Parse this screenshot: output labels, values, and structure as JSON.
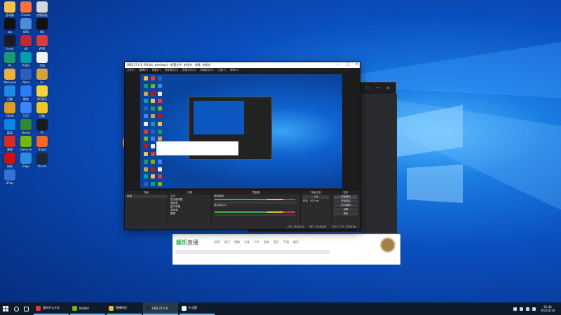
{
  "desktop": {
    "icons": [
      {
        "label": "此电脑",
        "color": "#f3c24b"
      },
      {
        "label": "Firefox",
        "color": "#ff7139"
      },
      {
        "label": "控制面板",
        "color": "#d8d8d8"
      },
      {
        "label": "ww",
        "color": "#111111"
      },
      {
        "label": "OBS",
        "color": "#4a8fd6"
      },
      {
        "label": "QQ",
        "color": "#111111"
      },
      {
        "label": "Faceit",
        "color": "#1b1b1b"
      },
      {
        "label": "UU",
        "color": "#cc2233"
      },
      {
        "label": "WPS",
        "color": "#e03a3a"
      },
      {
        "label": "PS",
        "color": "#1a9c6a"
      },
      {
        "label": "PUBG",
        "color": "#00a0b0"
      },
      {
        "label": "文档",
        "color": "#f4f4f4"
      },
      {
        "label": "WeGame",
        "color": "#e8b23b"
      },
      {
        "label": "Word",
        "color": "#2b5fb8"
      },
      {
        "label": "Go",
        "color": "#d6a23a"
      },
      {
        "label": "迅雷",
        "color": "#1e88e5"
      },
      {
        "label": "酷狗",
        "color": "#2e7bf6"
      },
      {
        "label": "QQ音乐",
        "color": "#f7d53a"
      },
      {
        "label": "CSGO",
        "color": "#dd9b2a"
      },
      {
        "label": "钉钉",
        "color": "#3a86ff"
      },
      {
        "label": "优酷",
        "color": "#f2c623"
      },
      {
        "label": "酷我",
        "color": "#0a86e3"
      },
      {
        "label": "Nvidia",
        "color": "#2f8a2f"
      },
      {
        "label": "Ps",
        "color": "#1a1a1a"
      },
      {
        "label": "雷神",
        "color": "#d92a2a"
      },
      {
        "label": "GeForce",
        "color": "#76b900"
      },
      {
        "label": "Origin",
        "color": "#f26b21"
      },
      {
        "label": "网易",
        "color": "#cc1111"
      },
      {
        "label": "Edge",
        "color": "#2c8ce0"
      },
      {
        "label": "Steam",
        "color": "#1b2838"
      },
      {
        "label": "UPlay",
        "color": "#2f75d1"
      }
    ]
  },
  "obs": {
    "title": "OBS 27.0.0 (64-bit, windows) - 配置文件: 未命名 - 场景: 未命名",
    "menu": [
      "文件(F)",
      "编辑(E)",
      "视图(V)",
      "停靠部件(D)",
      "配置文件(P)",
      "场景集合(S)",
      "工具(T)",
      "帮助(H)"
    ],
    "docks": {
      "scenes": {
        "header": "场景",
        "items": [
          "场景"
        ]
      },
      "sources": {
        "header": "来源",
        "items": [
          "文字",
          "显示器采集",
          "媒体源",
          "窗口采集",
          "游戏源",
          "图像"
        ]
      },
      "mixer": {
        "header": "混音器",
        "tracks": [
          "桌面音频",
          "麦克风/Aux"
        ]
      },
      "transitions": {
        "header": "场景过渡",
        "mode": "淡出",
        "duration_label": "时长",
        "duration": "300 ms"
      },
      "controls": {
        "header": "控件",
        "buttons": [
          "开始推流",
          "开始录制",
          "工作室模式",
          "设置",
          "退出"
        ]
      }
    },
    "status": [
      "LIVE: 00:00:00",
      "REC: 00:00:00",
      "CPU: 2.3%, 30.00 fps"
    ]
  },
  "music_app": {
    "logo_brand": "娱乐",
    "logo_rest": "直播",
    "tabs": [
      "首页",
      "热门",
      "频道",
      "分类",
      "户外",
      "游戏",
      "音乐",
      "手游",
      "娱乐"
    ]
  },
  "back_app": {
    "top_icons": [
      "⋮",
      "⬚",
      "─",
      "✕"
    ],
    "circle_label": "开始直播",
    "pill_label": "开播"
  },
  "taskbar": {
    "apps": [
      {
        "label": "我的开公众号",
        "color": "#e03a3a",
        "active": false
      },
      {
        "label": "NVIDIA",
        "color": "#76b900",
        "active": false
      },
      {
        "label": "直播伴侣",
        "color": "#e8b23b",
        "active": false
      },
      {
        "label": "OBS 27.0.0",
        "color": "#2c2c2c",
        "active": true
      },
      {
        "label": "9 设置",
        "color": "#ffffff",
        "active": false
      }
    ],
    "time": "21:46",
    "date": "2022/2/14"
  }
}
